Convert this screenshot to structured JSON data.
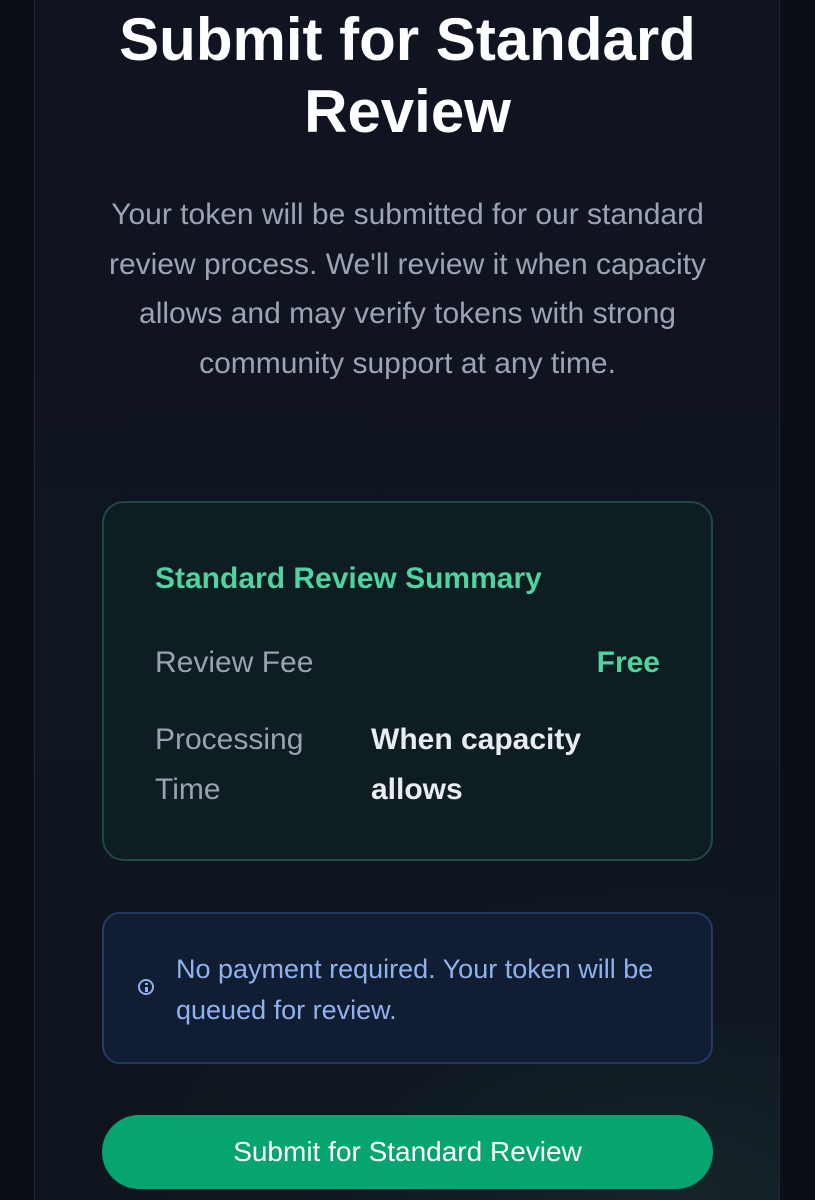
{
  "header": {
    "title": "Submit for Standard Review",
    "description": "Your token will be submitted for our standard review process. We'll review it when capacity allows and may verify tokens with strong community support at any time."
  },
  "summary": {
    "title": "Standard Review Summary",
    "fee_label": "Review Fee",
    "fee_value": "Free",
    "time_label": "Processing Time",
    "time_value": "When capacity allows"
  },
  "notice": {
    "icon": "info-icon",
    "text": "No payment required. Your token will be queued for review."
  },
  "actions": {
    "submit_label": "Submit for Standard Review"
  },
  "colors": {
    "accent_green": "#4fd39f",
    "button_green": "#06a570",
    "info_blue": "#8fb2ee"
  }
}
